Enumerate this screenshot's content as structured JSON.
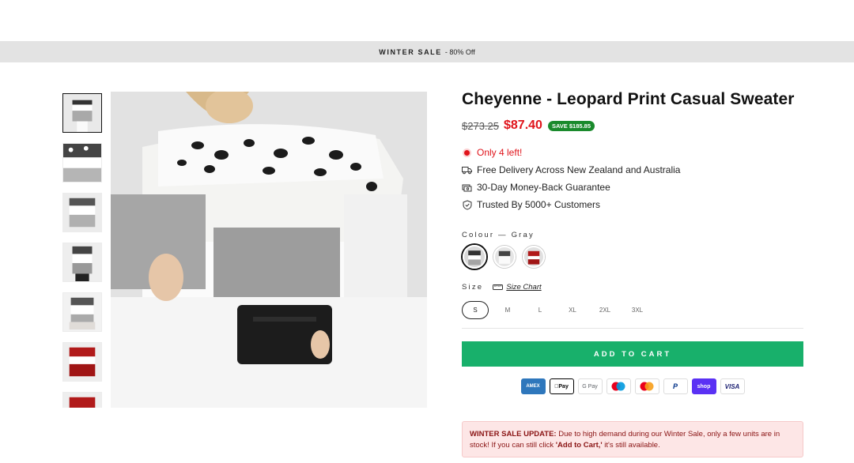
{
  "announcement": {
    "bold": "WINTER SALE",
    "text": "- 80% Off"
  },
  "product": {
    "title": "Cheyenne - Leopard Print Casual Sweater",
    "old_price": "$273.25",
    "new_price": "$87.40",
    "save_badge": "SAVE $185.85",
    "stock": "Only 4 left!",
    "features": [
      {
        "icon": "truck-icon",
        "text": "Free Delivery Across New Zealand and Australia"
      },
      {
        "icon": "money-back-icon",
        "text": "30-Day Money-Back Guarantee"
      },
      {
        "icon": "shield-check-icon",
        "text": "Trusted By 5000+ Customers"
      }
    ],
    "colour_label": "Colour",
    "colour_value": "Gray",
    "colour_options": [
      "Gray",
      "White",
      "Red"
    ],
    "size_label": "Size",
    "size_chart": "Size Chart",
    "sizes": [
      "S",
      "M",
      "L",
      "XL",
      "2XL",
      "3XL"
    ],
    "selected_size": "S",
    "add_to_cart": "ADD TO CART"
  },
  "payments": [
    {
      "name": "amex",
      "label": "AMEX",
      "bg": "#2e77bc",
      "fg": "#ffffff"
    },
    {
      "name": "apple-pay",
      "label": "Pay",
      "bg": "#ffffff",
      "fg": "#000000"
    },
    {
      "name": "google-pay",
      "label": "G Pay",
      "bg": "#ffffff",
      "fg": "#5f6368"
    },
    {
      "name": "maestro",
      "label": "",
      "bg": "#ffffff",
      "fg": "#000000"
    },
    {
      "name": "mastercard",
      "label": "",
      "bg": "#ffffff",
      "fg": "#000000"
    },
    {
      "name": "paypal",
      "label": "P",
      "bg": "#ffffff",
      "fg": "#003087"
    },
    {
      "name": "shop-pay",
      "label": "shop",
      "bg": "#5a31f4",
      "fg": "#ffffff"
    },
    {
      "name": "visa",
      "label": "VISA",
      "bg": "#ffffff",
      "fg": "#1a1f71"
    }
  ],
  "update_notice": {
    "bold": "WINTER SALE UPDATE:",
    "text1": " Due to high demand during our Winter Sale, only a few units are in stock! If you can still click ",
    "bold2": "'Add to Cart,'",
    "text2": " it's still available."
  },
  "colors": {
    "accent": "#18b06b",
    "price": "#e0141b",
    "badge": "#1a8a2c"
  }
}
